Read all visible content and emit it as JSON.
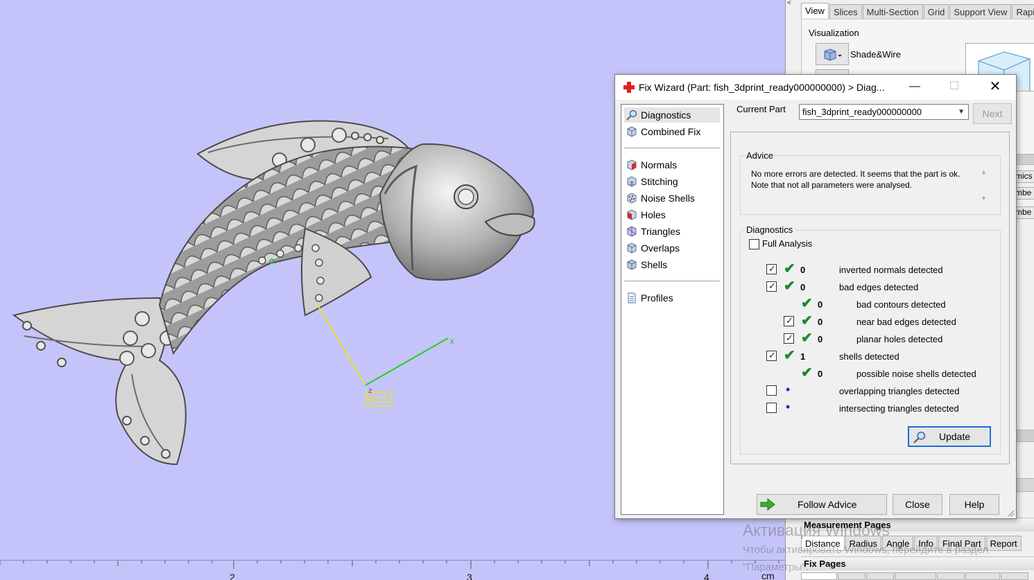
{
  "viewport": {
    "axis_x_label": "x",
    "axis_z_label": "z",
    "wcs_label": "WCS",
    "ruler": {
      "ticks": [
        "2",
        "3",
        "4"
      ],
      "unit": "cm"
    }
  },
  "right_panel": {
    "collapse_glyph": "<",
    "tabs": [
      "View",
      "Slices",
      "Multi-Section",
      "Grid",
      "Support View",
      "Rapidf"
    ],
    "active_tab": "View",
    "visualization": {
      "group_label": "Visualization",
      "mode_label": "Shade&Wire"
    },
    "clipped_labels": [
      "mics",
      "mbe",
      "mbe"
    ],
    "measurement": {
      "title": "Measurement Pages",
      "tabs": [
        "Distance",
        "Radius",
        "Angle",
        "Info",
        "Final Part",
        "Report"
      ],
      "active_tab": "Distance"
    },
    "fix_pages": {
      "title": "Fix Pages"
    },
    "activation": {
      "title": "Активация Windows",
      "line2": "Чтобы активировать Windows, перейдите в раздел",
      "line3": "\"Параметры\"."
    }
  },
  "wizard": {
    "title": "Fix Wizard (Part: fish_3dprint_ready000000000) > Diag...",
    "controls": {
      "minimize": "—",
      "maximize": "☐",
      "close": "✕"
    },
    "nav": {
      "top": [
        {
          "label": "Diagnostics",
          "icon": "magnifier-icon",
          "selected": true
        },
        {
          "label": "Combined Fix",
          "icon": "cube-icon"
        }
      ],
      "middle": [
        {
          "label": "Normals",
          "icon": "normals-icon"
        },
        {
          "label": "Stitching",
          "icon": "stitching-icon"
        },
        {
          "label": "Noise Shells",
          "icon": "noise-shells-icon"
        },
        {
          "label": "Holes",
          "icon": "holes-icon"
        },
        {
          "label": "Triangles",
          "icon": "triangles-icon"
        },
        {
          "label": "Overlaps",
          "icon": "overlaps-icon"
        },
        {
          "label": "Shells",
          "icon": "shells-icon"
        }
      ],
      "bottom": [
        {
          "label": "Profiles",
          "icon": "document-icon"
        }
      ]
    },
    "current_part": {
      "label": "Current Part",
      "value": "fish_3dprint_ready000000000"
    },
    "next_label": "Next",
    "advice": {
      "title": "Advice",
      "text": "No more errors are detected. It seems that the part is ok. Note that not all parameters were analysed."
    },
    "diagnostics": {
      "title": "Diagnostics",
      "full_analysis_label": "Full Analysis",
      "full_analysis_checked": false,
      "rows": [
        {
          "checkbox": true,
          "checked": true,
          "status": "ok",
          "count": "0",
          "label": "inverted normals detected",
          "indent": 0
        },
        {
          "checkbox": true,
          "checked": true,
          "status": "ok",
          "count": "0",
          "label": "bad edges detected",
          "indent": 0
        },
        {
          "checkbox": false,
          "checked": false,
          "status": "ok",
          "count": "0",
          "label": "bad contours detected",
          "indent": 1
        },
        {
          "checkbox": true,
          "checked": true,
          "status": "ok",
          "count": "0",
          "label": "near bad edges detected",
          "indent": 1
        },
        {
          "checkbox": true,
          "checked": true,
          "status": "ok",
          "count": "0",
          "label": "planar holes detected",
          "indent": 1
        },
        {
          "checkbox": true,
          "checked": true,
          "status": "ok",
          "count": "1",
          "label": "shells detected",
          "indent": 0
        },
        {
          "checkbox": false,
          "checked": false,
          "status": "ok",
          "count": "0",
          "label": "possible noise shells detected",
          "indent": 1
        },
        {
          "checkbox": true,
          "checked": false,
          "status": "none",
          "count": "",
          "label": "overlapping triangles detected",
          "indent": 0
        },
        {
          "checkbox": true,
          "checked": false,
          "status": "none",
          "count": "",
          "label": "intersecting triangles detected",
          "indent": 0
        }
      ]
    },
    "buttons": {
      "update": "Update",
      "follow_advice": "Follow Advice",
      "close": "Close",
      "help": "Help"
    },
    "colors": {
      "ok_tick": "#1a8a2a",
      "pending_dot": "#2030c0",
      "focus_border": "#1a6fd6",
      "title_icon": "#e02020"
    }
  }
}
